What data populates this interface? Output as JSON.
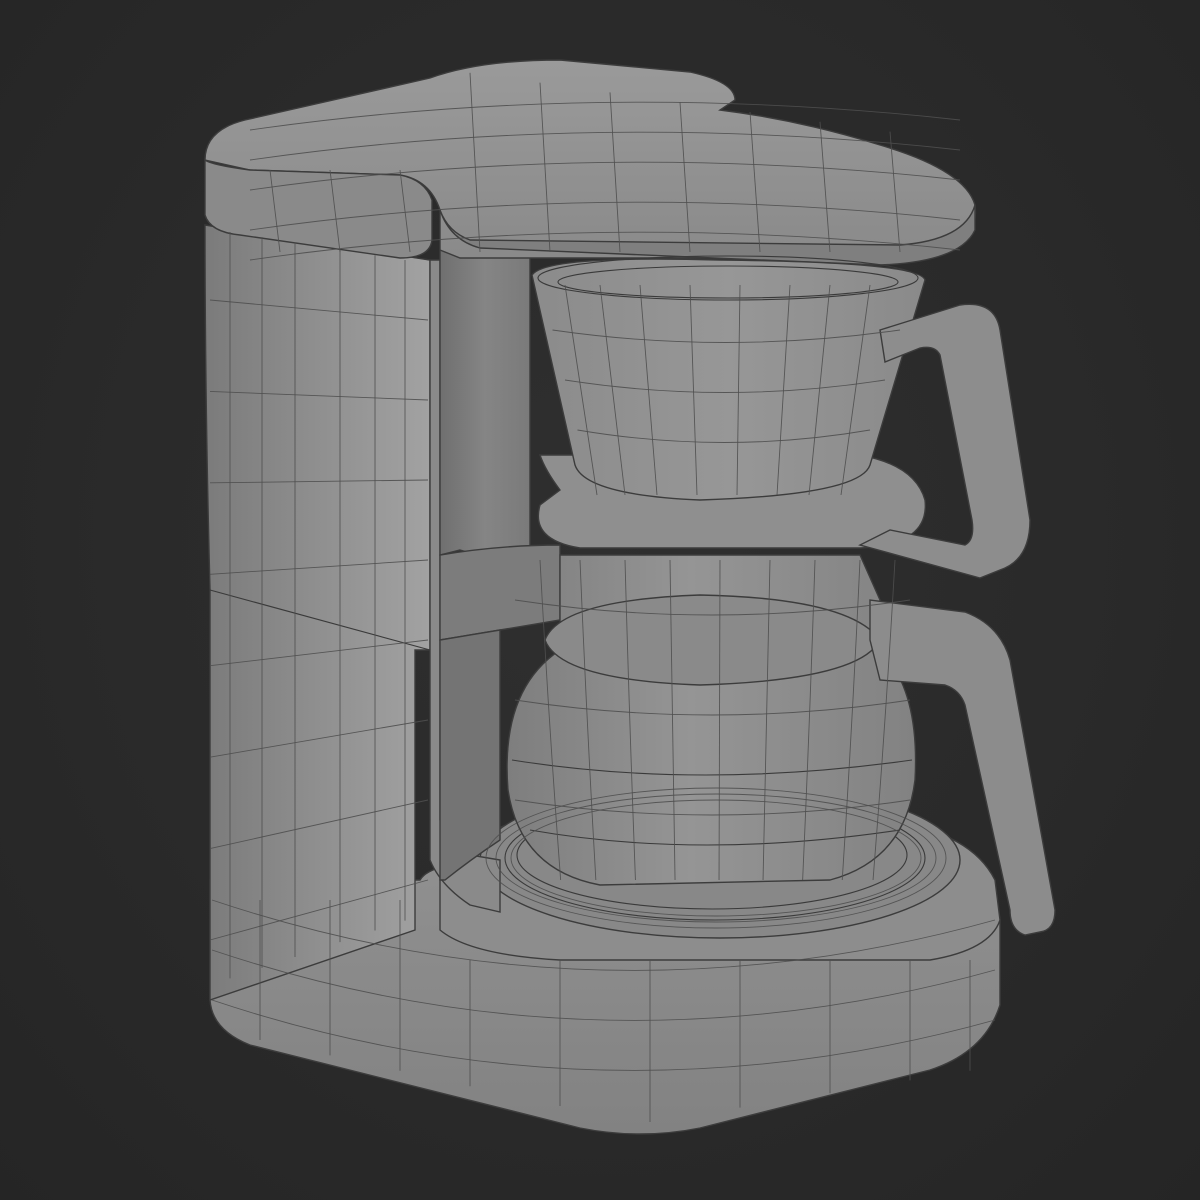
{
  "scene": {
    "object": "coffee maker",
    "view": "3d-viewport",
    "shading": "solid",
    "wireframe_overlay": true,
    "colors": {
      "background": "#2b2b2b",
      "surface": "#8e8e8e",
      "surface_light": "#a4a4a4",
      "surface_dark": "#6e6e6e",
      "wire": "#4f4f4f"
    }
  }
}
